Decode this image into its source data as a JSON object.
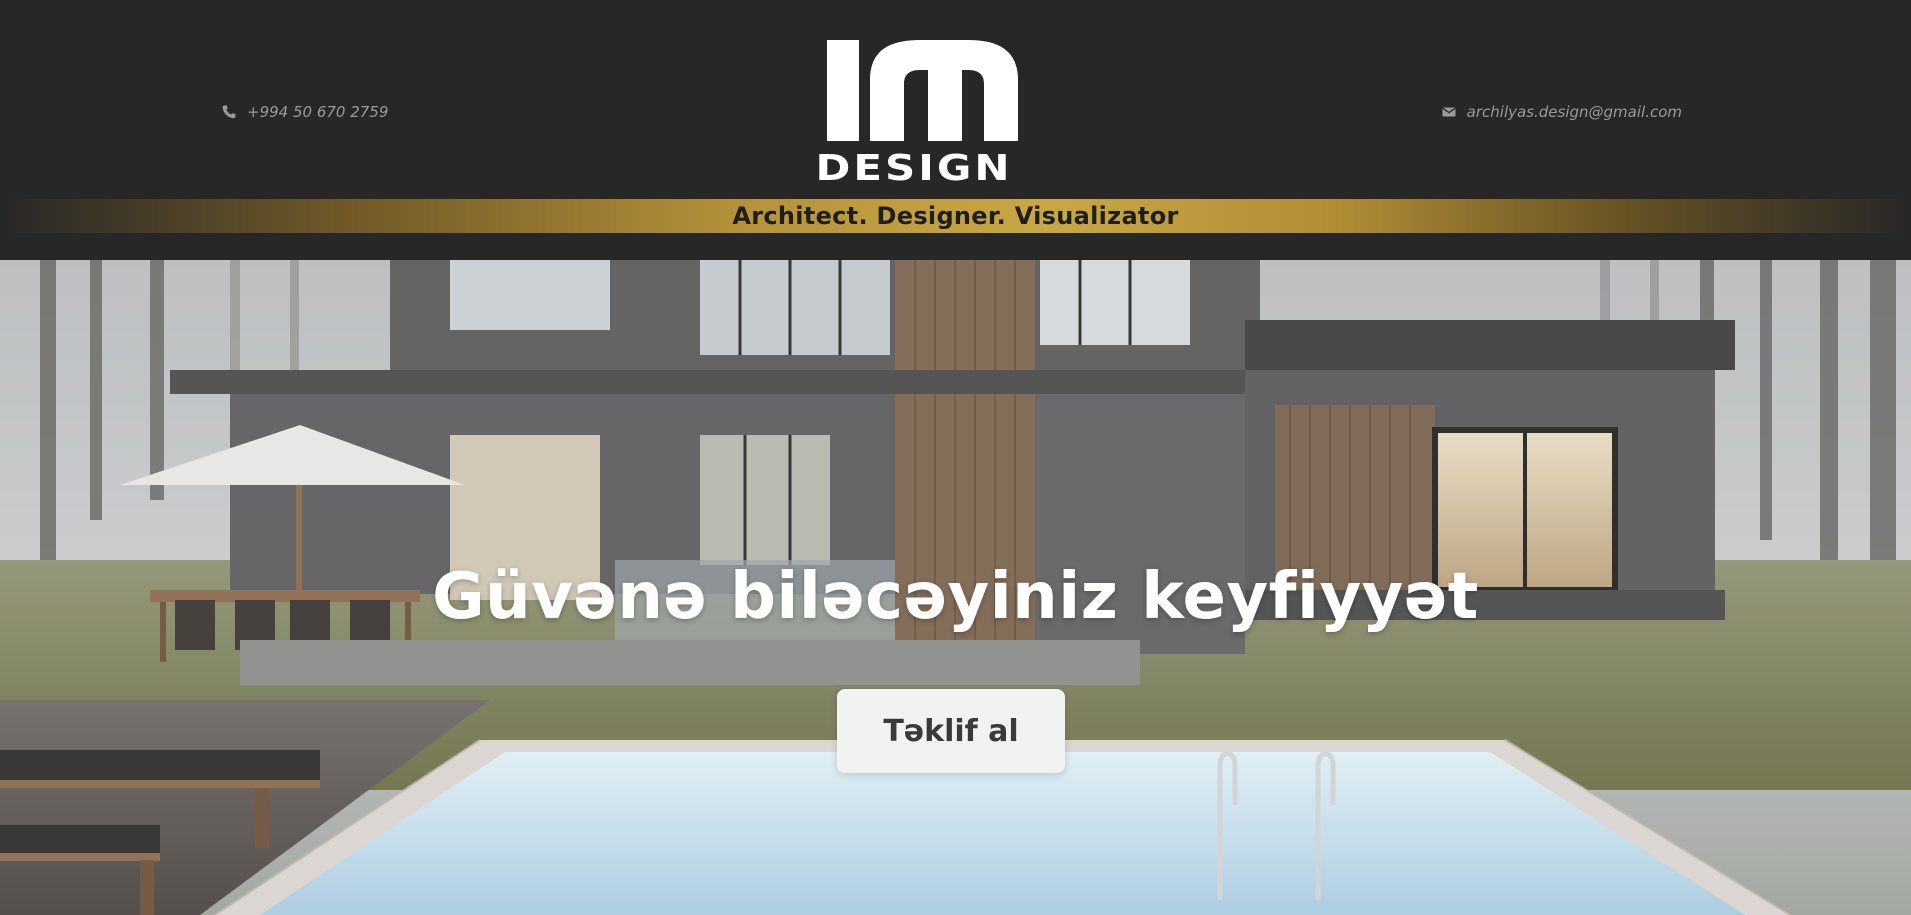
{
  "header": {
    "phone": "+994 50 670 2759",
    "email": "archilyas.design@gmail.com",
    "logo": {
      "mark": "IM",
      "wordmark": "DESIGN",
      "tagline": "Architect. Designer. Visualizator"
    }
  },
  "hero": {
    "title": "Güvənə biləcəyiniz keyfiyyət",
    "cta_label": "Təklif al"
  },
  "icons": {
    "phone": "phone-icon",
    "email": "envelope-icon"
  },
  "colors": {
    "header_bg": "#272727",
    "gold": "#c9a743",
    "text_muted": "#9a9a9a",
    "cta_bg": "#f2f2f2",
    "cta_text": "#3a3a3a"
  }
}
